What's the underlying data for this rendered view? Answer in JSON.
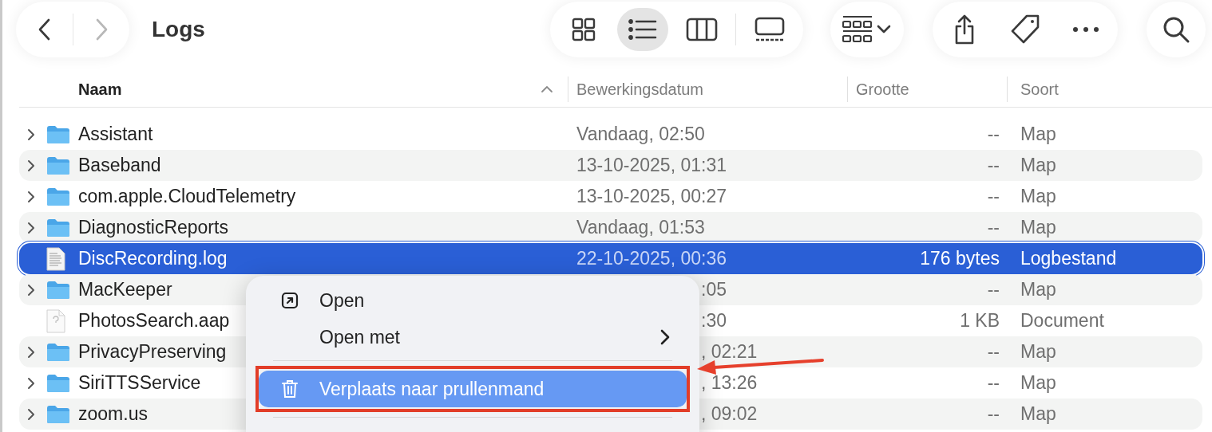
{
  "toolbar": {
    "title": "Logs",
    "back_enabled": true,
    "forward_enabled": false,
    "view_modes": [
      {
        "kind": "icons",
        "selected": false
      },
      {
        "kind": "list",
        "selected": true
      },
      {
        "kind": "columns",
        "selected": false
      },
      {
        "kind": "gallery",
        "selected": false
      }
    ]
  },
  "columns": [
    {
      "label": "Naam",
      "sorted": true
    },
    {
      "label": "Bewerkingsdatum",
      "sorted": false
    },
    {
      "label": "Grootte",
      "sorted": false
    },
    {
      "label": "Soort",
      "sorted": false
    }
  ],
  "rows": [
    {
      "name": "Assistant",
      "kind": "folder",
      "expandable": true,
      "date": "Vandaag, 02:50",
      "size": "--",
      "type": "Map",
      "selected": false
    },
    {
      "name": "Baseband",
      "kind": "folder",
      "expandable": true,
      "date": "13-10-2025, 01:31",
      "size": "--",
      "type": "Map",
      "selected": false
    },
    {
      "name": "com.apple.CloudTelemetry",
      "kind": "folder",
      "expandable": true,
      "date": "13-10-2025, 00:27",
      "size": "--",
      "type": "Map",
      "selected": false
    },
    {
      "name": "DiagnosticReports",
      "kind": "folder",
      "expandable": true,
      "date": "Vandaag, 01:53",
      "size": "--",
      "type": "Map",
      "selected": false
    },
    {
      "name": "DiscRecording.log",
      "kind": "log",
      "expandable": false,
      "date": "22-10-2025, 00:36",
      "size": "176 bytes",
      "type": "Logbestand",
      "selected": true
    },
    {
      "name": "MacKeeper",
      "kind": "folder",
      "expandable": true,
      "date": ":05",
      "size": "--",
      "type": "Map",
      "selected": false
    },
    {
      "name": "PhotosSearch.aap",
      "kind": "document",
      "expandable": false,
      "date": ":30",
      "size": "1 KB",
      "type": "Document",
      "selected": false
    },
    {
      "name": "PrivacyPreserving",
      "kind": "folder",
      "expandable": true,
      "date": ", 02:21",
      "size": "--",
      "type": "Map",
      "selected": false
    },
    {
      "name": "SiriTTSService",
      "kind": "folder",
      "expandable": true,
      "date": ", 13:26",
      "size": "--",
      "type": "Map",
      "selected": false
    },
    {
      "name": "zoom.us",
      "kind": "folder",
      "expandable": true,
      "date": ", 09:02",
      "size": "--",
      "type": "Map",
      "selected": false
    }
  ],
  "context_menu": {
    "items": [
      {
        "kind": "open",
        "label": "Open",
        "submenu": false,
        "highlighted": false,
        "annotated": false
      },
      {
        "kind": "open_with",
        "label": "Open met",
        "submenu": true,
        "highlighted": false,
        "annotated": false
      },
      {
        "kind": "separator"
      },
      {
        "kind": "trash",
        "label": "Verplaats naar prullenmand",
        "submenu": false,
        "highlighted": true,
        "annotated": true
      },
      {
        "kind": "separator"
      }
    ]
  }
}
